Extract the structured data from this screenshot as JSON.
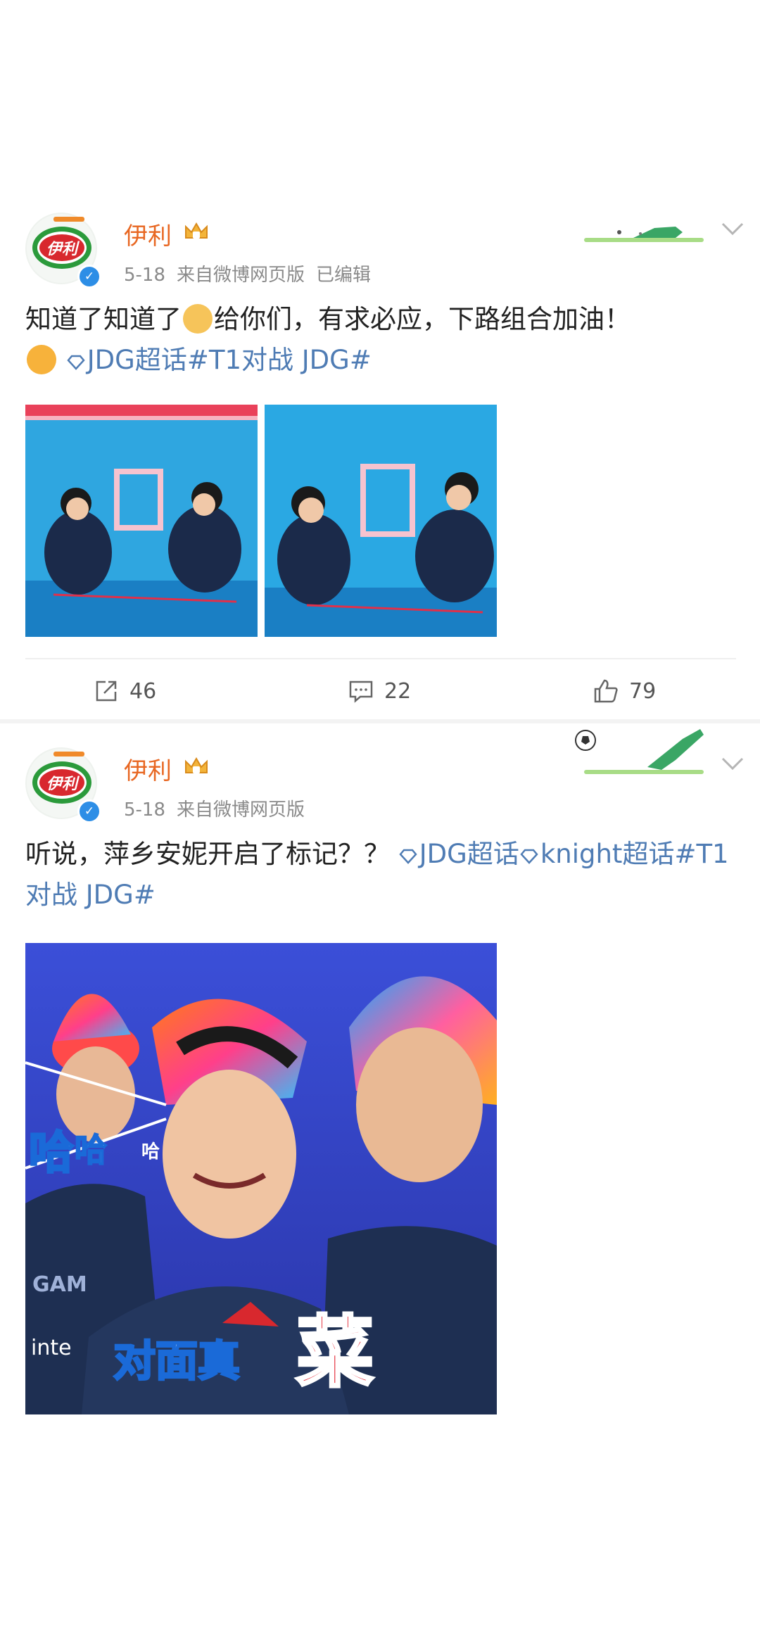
{
  "posts": [
    {
      "author": "伊利",
      "date": "5-18",
      "source": "来自微博网页版",
      "edited": "已编辑",
      "text_1": "知道了知道了",
      "text_2": "给你们，有求必应，下路组合加油！",
      "topic_1": "JDG超话",
      "topic_2": "#T1对战 JDG#",
      "actions": {
        "share": "46",
        "comment": "22",
        "like": "79"
      }
    },
    {
      "author": "伊利",
      "date": "5-18",
      "source": "来自微博网页版",
      "text_1": "听说，萍乡安妮开启了标记？？",
      "topic_1": "JDG超话",
      "topic_2": "knight超话",
      "topic_3": "#T1对战 JDG#",
      "image_caption_1": "哈",
      "image_caption_2": "哈",
      "image_caption_3": "哈",
      "image_caption_4": "对面真",
      "image_caption_5": "菜",
      "image_caption_6": "GAM",
      "image_caption_7": "inte"
    }
  ],
  "avatar_logo_text": "伊利",
  "icons": {
    "share": "share-icon",
    "comment": "comment-icon",
    "like": "thumbs-up-icon",
    "more": "chevron-down-icon",
    "verified": "verified-badge-icon",
    "vip": "vip-crown-icon",
    "topic": "diamond-icon"
  },
  "colors": {
    "author": "#e86722",
    "topic": "#4f7cb4",
    "meta": "#8a8a8a",
    "verified": "#2d8ee6"
  }
}
